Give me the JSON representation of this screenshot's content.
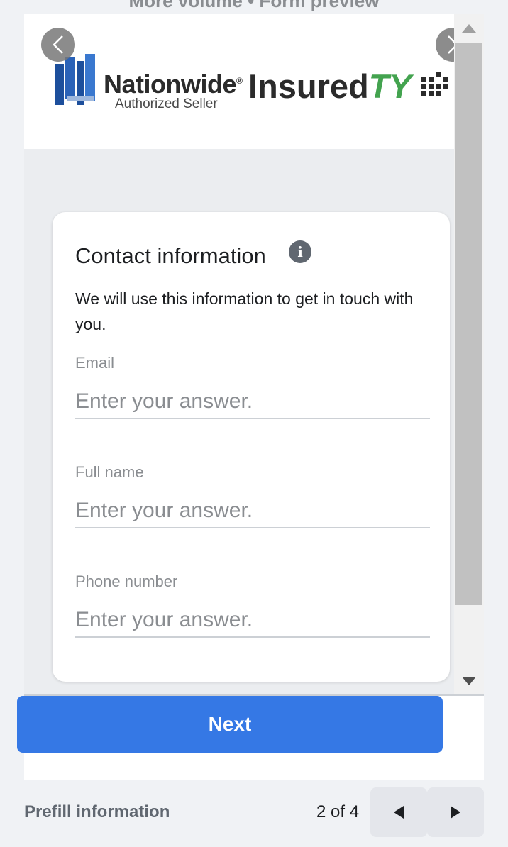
{
  "top_cut_text": "More volume • Form preview",
  "header": {
    "nationwide_word": "Nationwide",
    "nationwide_mark": "®",
    "nationwide_sub": "Authorized Seller",
    "insured_word": "Insured",
    "insured_ty": "TY",
    "prev_icon": "chevron-left-icon",
    "next_icon": "chevron-right-icon"
  },
  "card": {
    "title": "Contact information",
    "info_icon": "i",
    "description": "We will use this information to get in touch with you.",
    "fields": [
      {
        "label": "Email",
        "placeholder": "Enter your answer."
      },
      {
        "label": "Full name",
        "placeholder": "Enter your answer."
      },
      {
        "label": "Phone number",
        "placeholder": "Enter your answer."
      }
    ]
  },
  "footer": {
    "next_label": "Next",
    "prefill_label": "Prefill information",
    "pager": "2 of 4"
  },
  "colors": {
    "primary_button": "#3578e5",
    "brand_green": "#43a34f"
  }
}
